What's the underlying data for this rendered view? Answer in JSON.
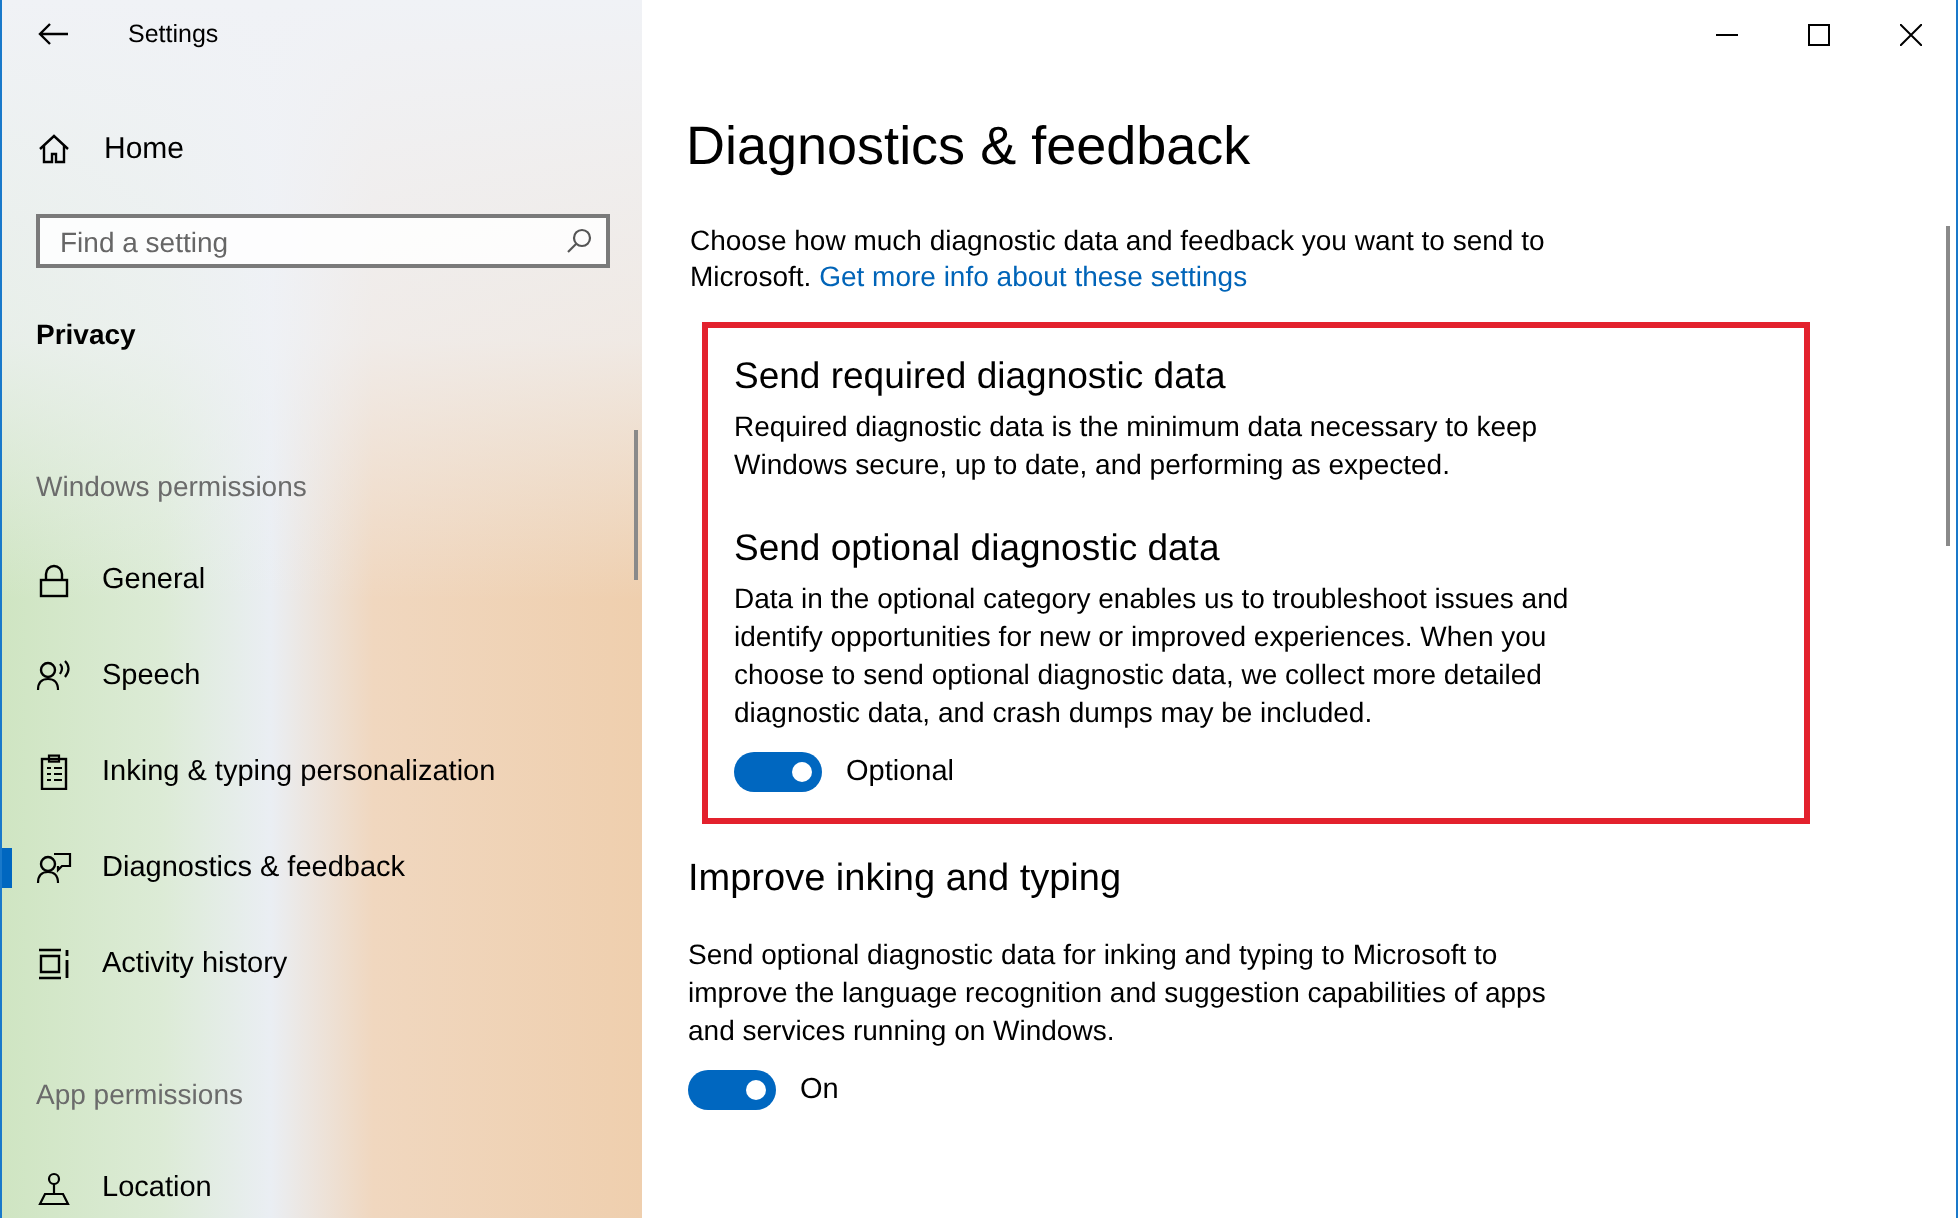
{
  "window": {
    "title": "Settings"
  },
  "sidebar": {
    "home": "Home",
    "search": {
      "placeholder": "Find a setting"
    },
    "section": "Privacy",
    "groups": [
      {
        "heading": "Windows permissions",
        "items": [
          {
            "label": "General",
            "selected": false
          },
          {
            "label": "Speech",
            "selected": false
          },
          {
            "label": "Inking & typing personalization",
            "selected": false
          },
          {
            "label": "Diagnostics & feedback",
            "selected": true
          },
          {
            "label": "Activity history",
            "selected": false
          }
        ]
      },
      {
        "heading": "App permissions",
        "items": [
          {
            "label": "Location",
            "selected": false
          }
        ]
      }
    ]
  },
  "page": {
    "title": "Diagnostics & feedback",
    "intro": "Choose how much diagnostic data and feedback you want to send to Microsoft.",
    "intro_link": "Get more info about these settings",
    "highlighted_sections": [
      {
        "heading": "Send required diagnostic data",
        "text": "Required diagnostic data is the minimum data necessary to keep Windows secure, up to date, and performing as expected."
      },
      {
        "heading": "Send optional diagnostic data",
        "text": "Data in the optional category enables us to troubleshoot issues and identify opportunities for new or improved experiences. When you choose to send optional diagnostic data, we collect more detailed diagnostic data, and crash dumps may be included.",
        "toggle": {
          "on": true,
          "label": "Optional"
        }
      }
    ],
    "sections": [
      {
        "heading": "Improve inking and typing",
        "text": "Send optional diagnostic data for inking and typing to Microsoft to improve the language recognition and suggestion capabilities of apps and services running on Windows.",
        "toggle": {
          "on": true,
          "label": "On"
        }
      }
    ]
  }
}
